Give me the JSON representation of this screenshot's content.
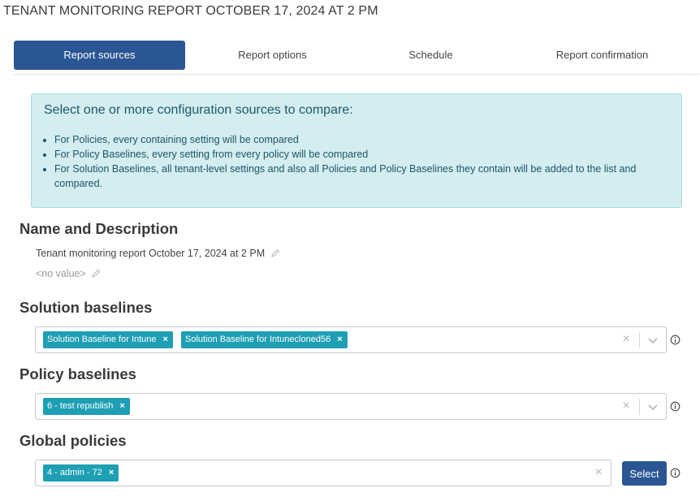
{
  "page": {
    "title": "TENANT MONITORING REPORT OCTOBER 17, 2024 AT 2 PM"
  },
  "tabs": [
    {
      "label": "Report sources",
      "active": true
    },
    {
      "label": "Report options",
      "active": false
    },
    {
      "label": "Schedule",
      "active": false
    },
    {
      "label": "Report confirmation",
      "active": false
    }
  ],
  "info": {
    "heading": "Select one or more configuration sources to compare:",
    "items": [
      "For Policies, every containing setting will be compared",
      "For Policy Baselines, every setting from every policy will be compared",
      "For Solution Baselines, all tenant-level settings and also all Policies and Policy Baselines they contain will be added to the list and compared."
    ]
  },
  "name_section": {
    "title": "Name and Description",
    "name_value": "Tenant monitoring report October 17, 2024 at 2 PM",
    "description_value": "<no value>"
  },
  "solution_baselines": {
    "title": "Solution baselines",
    "chips": [
      "Solution Baseline for Intune",
      "Solution Baseline for Intunecloned56"
    ]
  },
  "policy_baselines": {
    "title": "Policy baselines",
    "chips": [
      "6 - test republish"
    ]
  },
  "global_policies": {
    "title": "Global policies",
    "chips": [
      "4 - admin - 72"
    ],
    "select_label": "Select"
  },
  "icons": {
    "pencil": "pencil-icon",
    "remove": "close-icon",
    "clear": "clear-icon",
    "dropdown": "chevron-down-icon",
    "info": "info-icon"
  },
  "colors": {
    "primary": "#2a5694",
    "chip": "#1e9fb3",
    "info_bg": "#d3edf1",
    "info_text": "#1b5a68"
  }
}
